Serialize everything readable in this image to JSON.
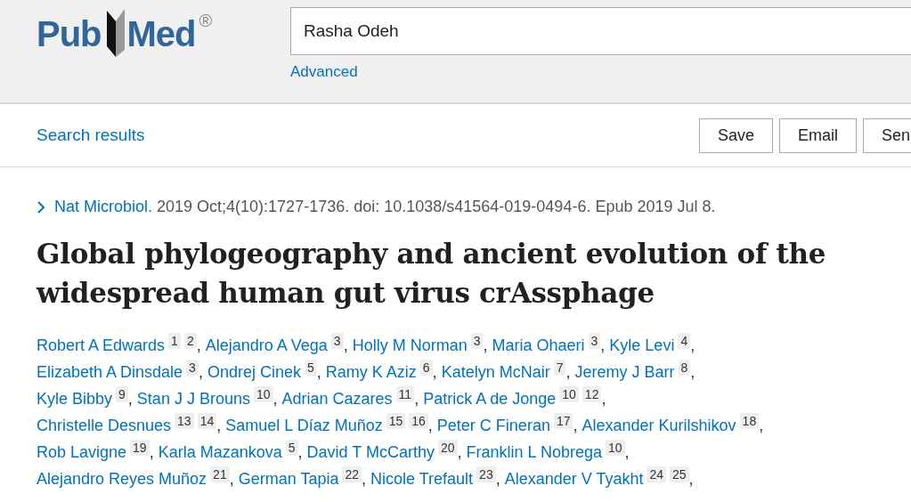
{
  "logo": {
    "left": "Pub",
    "right": "Med",
    "mark": "®"
  },
  "search": {
    "value": "Rasha Odeh"
  },
  "advanced_link": "Advanced",
  "toolbar": {
    "back_link": "Search results",
    "buttons": [
      "Save",
      "Email",
      "Sen"
    ]
  },
  "citation": {
    "journal": "Nat Microbiol.",
    "details": " 2019 Oct;4(10):1727-1736. doi: 10.1038/s41564-019-0494-6. Epub 2019 Jul 8."
  },
  "title_lines": [
    "Global phylogeography and ancient evolution of the",
    "widespread human gut virus crAssphage"
  ],
  "author_lines": [
    [
      {
        "name": "Robert A Edwards",
        "affiliations": [
          "1",
          "2"
        ],
        "separator": ","
      },
      {
        "name": "Alejandro A Vega",
        "affiliations": [
          "3"
        ],
        "separator": ","
      },
      {
        "name": "Holly M Norman",
        "affiliations": [
          "3"
        ],
        "separator": ","
      },
      {
        "name": "Maria Ohaeri",
        "affiliations": [
          "3"
        ],
        "separator": ","
      },
      {
        "name": "Kyle Levi",
        "affiliations": [
          "4"
        ],
        "separator": ","
      }
    ],
    [
      {
        "name": "Elizabeth A Dinsdale",
        "affiliations": [
          "3"
        ],
        "separator": ","
      },
      {
        "name": "Ondrej Cinek",
        "affiliations": [
          "5"
        ],
        "separator": ","
      },
      {
        "name": "Ramy K Aziz",
        "affiliations": [
          "6"
        ],
        "separator": ","
      },
      {
        "name": "Katelyn McNair",
        "affiliations": [
          "7"
        ],
        "separator": ","
      },
      {
        "name": "Jeremy J Barr",
        "affiliations": [
          "8"
        ],
        "separator": ","
      }
    ],
    [
      {
        "name": "Kyle Bibby",
        "affiliations": [
          "9"
        ],
        "separator": ","
      },
      {
        "name": "Stan J J Brouns",
        "affiliations": [
          "10"
        ],
        "separator": ","
      },
      {
        "name": "Adrian Cazares",
        "affiliations": [
          "11"
        ],
        "separator": ","
      },
      {
        "name": "Patrick A de Jonge",
        "affiliations": [
          "10",
          "12"
        ],
        "separator": ","
      }
    ],
    [
      {
        "name": "Christelle Desnues",
        "affiliations": [
          "13",
          "14"
        ],
        "separator": ","
      },
      {
        "name": "Samuel L Díaz Muñoz",
        "affiliations": [
          "15",
          "16"
        ],
        "separator": ","
      },
      {
        "name": "Peter C Fineran",
        "affiliations": [
          "17"
        ],
        "separator": ","
      },
      {
        "name": "Alexander Kurilshikov",
        "affiliations": [
          "18"
        ],
        "separator": ","
      }
    ],
    [
      {
        "name": "Rob Lavigne",
        "affiliations": [
          "19"
        ],
        "separator": ","
      },
      {
        "name": "Karla Mazankova",
        "affiliations": [
          "5"
        ],
        "separator": ","
      },
      {
        "name": "David T McCarthy",
        "affiliations": [
          "20"
        ],
        "separator": ","
      },
      {
        "name": "Franklin L Nobrega",
        "affiliations": [
          "10"
        ],
        "separator": ","
      }
    ],
    [
      {
        "name": "Alejandro Reyes Muñoz",
        "affiliations": [
          "21"
        ],
        "separator": ","
      },
      {
        "name": "German Tapia",
        "affiliations": [
          "22"
        ],
        "separator": ","
      },
      {
        "name": "Nicole Trefault",
        "affiliations": [
          "23"
        ],
        "separator": ","
      },
      {
        "name": "Alexander V Tyakht",
        "affiliations": [
          "24",
          "25"
        ],
        "separator": ","
      }
    ]
  ]
}
